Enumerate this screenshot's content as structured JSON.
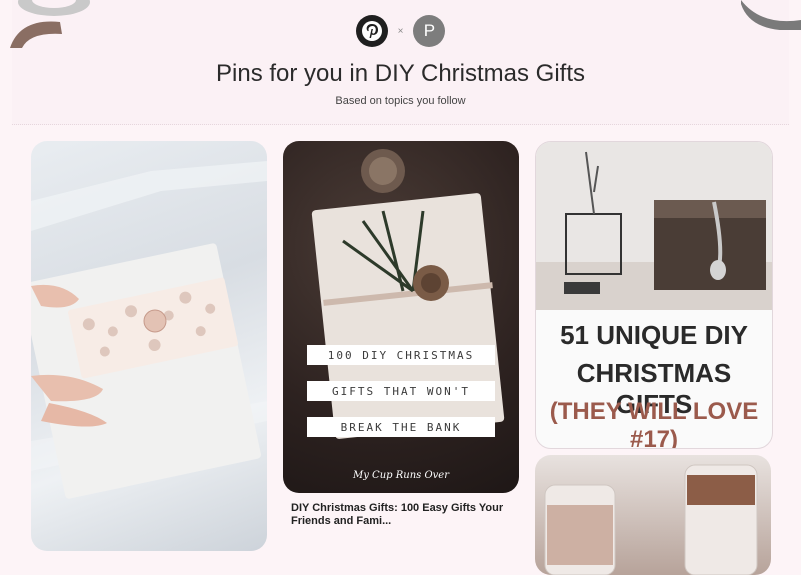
{
  "header": {
    "title": "Pins for you in DIY Christmas Gifts",
    "subtitle": "Based on topics you follow",
    "separator": "×",
    "avatar_initial": "P"
  },
  "pins": [
    {
      "kind": "image",
      "icon": "gift-box-photo"
    },
    {
      "kind": "image-with-text",
      "overlay_lines": [
        "100 DIY CHRISTMAS",
        "GIFTS THAT WON'T",
        "BREAK THE BANK"
      ],
      "brand": "My Cup Runs Over",
      "caption": "DIY Christmas Gifts: 100 Easy Gifts Your Friends and Fami..."
    },
    {
      "kind": "image-with-text",
      "headline_lines": [
        "51 UNIQUE DIY",
        "CHRISTMAS GIFTS",
        "(THEY WILL LOVE #17)"
      ],
      "headline_colors": [
        "#2a2a2a",
        "#2a2a2a",
        "#9b5a4c"
      ]
    },
    {
      "kind": "image",
      "icon": "jar-photo"
    }
  ]
}
